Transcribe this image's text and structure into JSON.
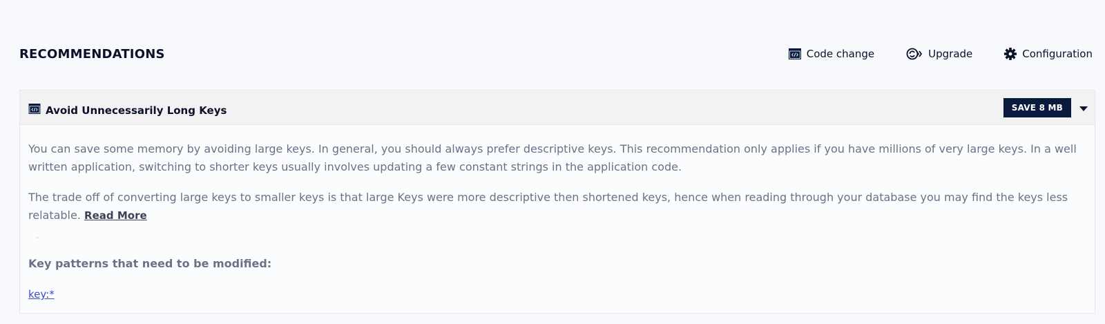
{
  "header": {
    "title": "RECOMMENDATIONS",
    "filters": [
      {
        "label": "Code change",
        "icon": "code-window-icon"
      },
      {
        "label": "Upgrade",
        "icon": "upgrade-icon"
      },
      {
        "label": "Configuration",
        "icon": "gear-icon"
      }
    ]
  },
  "recommendation": {
    "title": "Avoid Unnecessarily Long Keys",
    "title_icon": "code-window-icon",
    "badge": "SAVE 8 MB",
    "paragraph1": "You can save some memory by avoiding large keys. In general, you should always prefer descriptive keys. This recommendation only applies if you have millions of very large keys. In a well written application, switching to shorter keys usually involves updating a few constant strings in the application code.",
    "paragraph2": "The trade off of converting large keys to smaller keys is that large Keys were more descriptive then shortened keys, hence when reading through your database you may find the keys less relatable.",
    "read_more": "Read More",
    "patterns_heading": "Key patterns that need to be modified:",
    "patterns": [
      "key:*"
    ]
  },
  "colors": {
    "page_bg": "#f8f9fd",
    "badge_bg": "#0a1a3f",
    "link": "#3a4bc4",
    "muted_text": "#6b7186"
  }
}
